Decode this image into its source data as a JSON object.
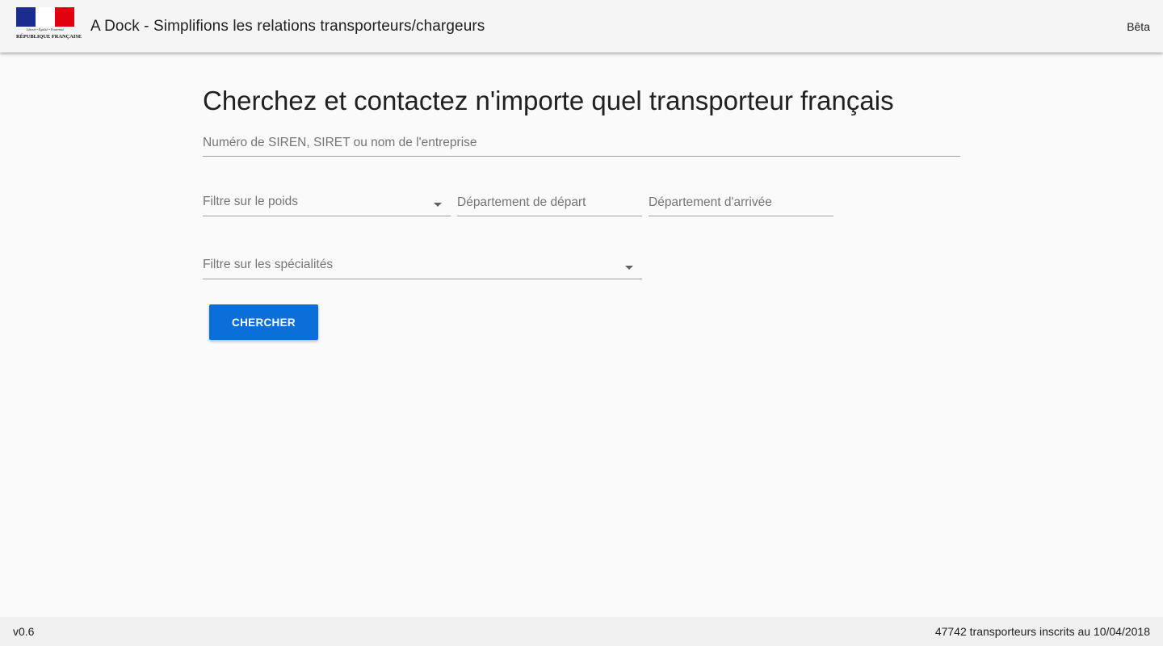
{
  "header": {
    "logo": {
      "motto": "Liberté • Égalité • Fraternité",
      "republic": "RÉPUBLIQUE FRANÇAISE",
      "colors": [
        "#1a2d8f",
        "#ffffff",
        "#e1000f"
      ]
    },
    "title": "A Dock - Simplifions les relations transporteurs/chargeurs",
    "badge": "Bêta"
  },
  "main": {
    "title": "Cherchez et contactez n'importe quel transporteur français",
    "search": {
      "placeholder": "Numéro de SIREN, SIRET ou nom de l'entreprise",
      "value": ""
    },
    "filters": {
      "weight": {
        "label": "Filtre sur le poids",
        "icon": "arrow-drop-down-icon"
      },
      "departure": {
        "placeholder": "Département de départ",
        "value": ""
      },
      "arrival": {
        "placeholder": "Département d'arrivée",
        "value": ""
      },
      "specialties": {
        "label": "Filtre sur les spécialités",
        "icon": "arrow-drop-down-icon"
      }
    },
    "search_button": {
      "label": "CHERCHER",
      "color": "#0a6fd8"
    }
  },
  "footer": {
    "version": "v0.6",
    "stats": "47742 transporteurs inscrits au 10/04/2018"
  }
}
